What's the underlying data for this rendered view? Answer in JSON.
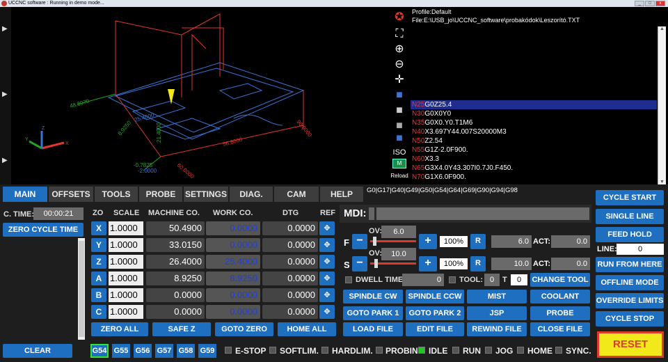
{
  "window": {
    "title": "UCCNC software : Running in demo mode..."
  },
  "view": {
    "labels": [
      {
        "text": "48.8970",
        "color": "#1fa81f"
      },
      {
        "text": "25.4000",
        "color": "#3a74d8"
      },
      {
        "text": "8.9250",
        "color": "#1fa81f"
      },
      {
        "text": "21.4000",
        "color": "#1fa81f"
      },
      {
        "text": "-0.7825",
        "color": "#1fa81f"
      },
      {
        "text": "-2.0000",
        "color": "#3a74d8"
      },
      {
        "text": "56.8000",
        "color": "#e0372c"
      },
      {
        "text": "90.0000",
        "color": "#e0372c"
      },
      {
        "text": "60.0000",
        "color": "#e0372c"
      }
    ],
    "axes": {
      "x": "X",
      "y": "Y",
      "z": "Z"
    }
  },
  "view_tools": {
    "icons": [
      "logo-icon",
      "fit-icon",
      "zoom-in-icon",
      "zoom-out-icon",
      "pan-icon",
      "cube-top-icon",
      "cube-front-icon",
      "cube-side-icon",
      "cube-iso-icon"
    ],
    "iso_label": "ISO",
    "reload_label": "Reload",
    "reload_badge": "M"
  },
  "program": {
    "profile": "Profile:Default",
    "file": "File:E:\\USB_jo\\UCCNC_software\\probakódok\\Leszorító.TXT",
    "lines": [
      {
        "n": "N25",
        "code": "G0Z25.4"
      },
      {
        "n": "N30",
        "code": "G0X0Y0"
      },
      {
        "n": "N35",
        "code": "G0X0.Y0.T1M6"
      },
      {
        "n": "N40",
        "code": "X3.697Y44.007S20000M3"
      },
      {
        "n": "N50",
        "code": "Z2.54"
      },
      {
        "n": "N55",
        "code": "G1Z-2.0F900."
      },
      {
        "n": "N60",
        "code": "X3.3"
      },
      {
        "n": "N65",
        "code": "G3X4.0Y43.307I0.7J0.F450."
      },
      {
        "n": "N70",
        "code": "G1X6.0F900."
      }
    ]
  },
  "tabs": [
    "MAIN",
    "OFFSETS",
    "TOOLS",
    "PROBE",
    "SETTINGS",
    "DIAG.",
    "CAM",
    "HELP"
  ],
  "modal_codes": "G0|G17|G40|G49|G50|G54|G64|G69|G90|G94|G98",
  "left": {
    "ctime_label": "C. TIME:",
    "ctime_value": "00:00:21",
    "zero_cycle": "ZERO CYCLE TIME",
    "clear": "CLEAR"
  },
  "dro": {
    "headers": {
      "zo": "ZO",
      "scale": "SCALE",
      "machine": "MACHINE CO.",
      "work": "WORK CO.",
      "dtg": "DTG",
      "ref": "REF"
    },
    "axes": [
      {
        "name": "X",
        "scale": "1.0000",
        "machine": "50.4900",
        "work": "0.0000",
        "dtg": "0.0000"
      },
      {
        "name": "Y",
        "scale": "1.0000",
        "machine": "33.0150",
        "work": "0.0000",
        "dtg": "0.0000"
      },
      {
        "name": "Z",
        "scale": "1.0000",
        "machine": "26.4000",
        "work": "25.4000",
        "dtg": "0.0000"
      },
      {
        "name": "A",
        "scale": "1.0000",
        "machine": "8.9250",
        "work": "8.9250",
        "dtg": "0.0000"
      },
      {
        "name": "B",
        "scale": "1.0000",
        "machine": "0.0000",
        "work": "0.0000",
        "dtg": "0.0000"
      },
      {
        "name": "C",
        "scale": "1.0000",
        "machine": "0.0000",
        "work": "0.0000",
        "dtg": "0.0000"
      }
    ],
    "buttons": [
      "ZERO ALL",
      "SAFE Z",
      "GOTO ZERO",
      "HOME ALL"
    ],
    "fixtures": [
      "G54",
      "G55",
      "G56",
      "G57",
      "G58",
      "G59"
    ],
    "active_fixture": "G54"
  },
  "mdi": {
    "label": "MDI:",
    "value": ""
  },
  "feed": {
    "label": "F",
    "ov_label": "OV:",
    "ov": "6.0",
    "pct": "100%",
    "r": "R",
    "value": "6.0",
    "act_label": "ACT:",
    "act": "0.0",
    "slider": 0.06
  },
  "spindle": {
    "label": "S",
    "ov_label": "OV:",
    "ov": "10.0",
    "pct": "100%",
    "r": "R",
    "value": "10.0",
    "act_label": "ACT:",
    "act": "0.0",
    "slider": 0.1
  },
  "dwell": {
    "label": "DWELL TIME:",
    "value": "0",
    "tool_label": "TOOL:",
    "tool": "0",
    "t_label": "T",
    "t": "0",
    "change": "CHANGE TOOL"
  },
  "func_buttons": [
    "SPINDLE CW",
    "SPINDLE CCW",
    "MIST",
    "COOLANT",
    "GOTO PARK 1",
    "GOTO PARK 2",
    "JSP",
    "PROBE",
    "LOAD FILE",
    "EDIT FILE",
    "REWIND FILE",
    "CLOSE FILE"
  ],
  "right": {
    "cycle_start": "CYCLE START",
    "single_line": "SINGLE LINE",
    "feed_hold": "FEED HOLD",
    "line_label": "LINE:",
    "line_value": "0",
    "run_from_here": "RUN FROM HERE",
    "offline_mode": "OFFLINE MODE",
    "override_limits": "OVERRIDE LIMITS",
    "cycle_stop": "CYCLE STOP",
    "reset": "RESET"
  },
  "status": [
    {
      "label": "E-STOP",
      "on": false
    },
    {
      "label": "SOFTLIM.",
      "on": false
    },
    {
      "label": "HARDLIM.",
      "on": false
    },
    {
      "label": "PROBING",
      "on": false
    },
    {
      "label": "IDLE",
      "on": true
    },
    {
      "label": "RUN",
      "on": false
    },
    {
      "label": "JOG",
      "on": false
    },
    {
      "label": "HOME",
      "on": false
    },
    {
      "label": "SYNC.",
      "on": false
    }
  ]
}
